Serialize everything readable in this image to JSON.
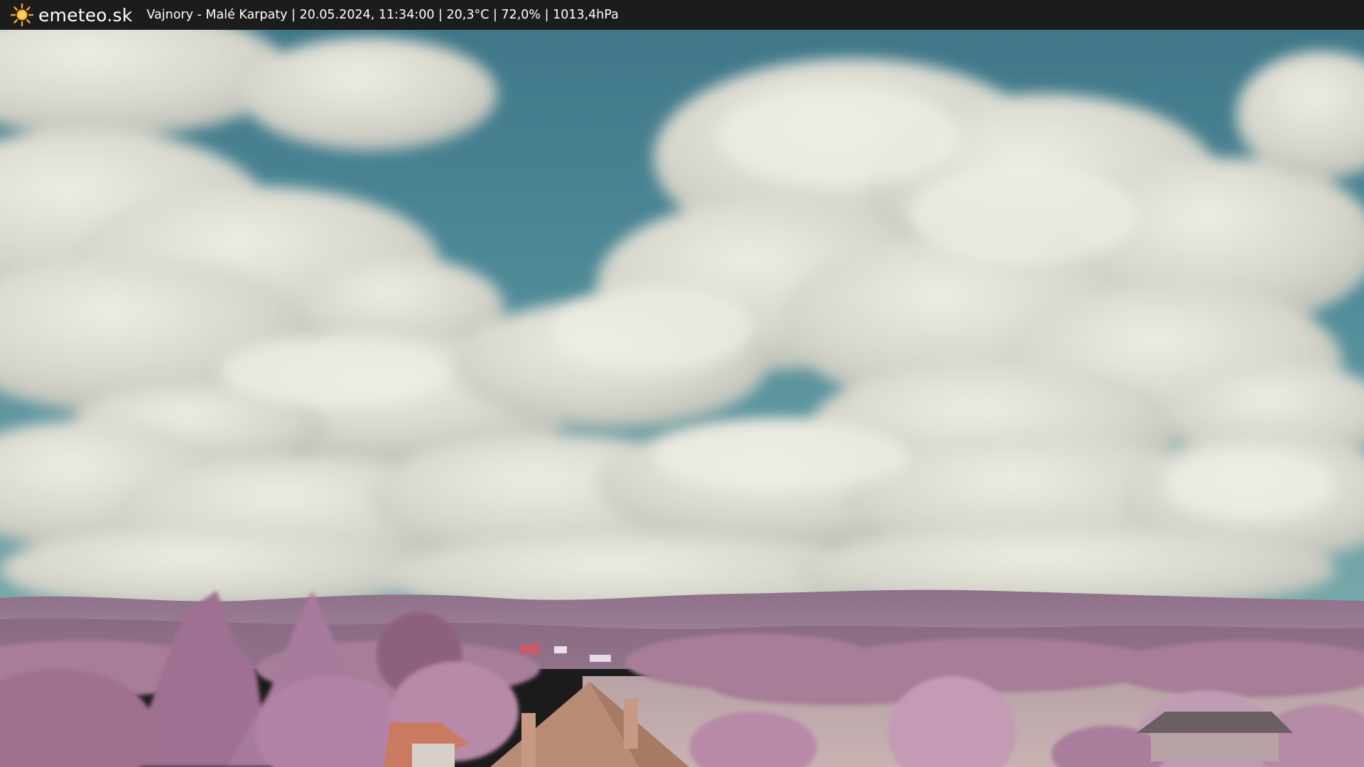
{
  "header": {
    "logo_icon": "sun-icon",
    "brand": "emeteo.sk",
    "caption": "Vajnory - Malé Karpaty | 20.05.2024, 11:34:00 | 20,3°C | 72,0% | 1013,4hPa"
  },
  "colors": {
    "topbar": "#1c1c1c",
    "sun": "#f5a623",
    "sky": "#4f8a98",
    "cloud": "#dcdcd2",
    "hills": "#9c7a96",
    "foliage": "#b88aa8",
    "roof": "#c97a60"
  }
}
